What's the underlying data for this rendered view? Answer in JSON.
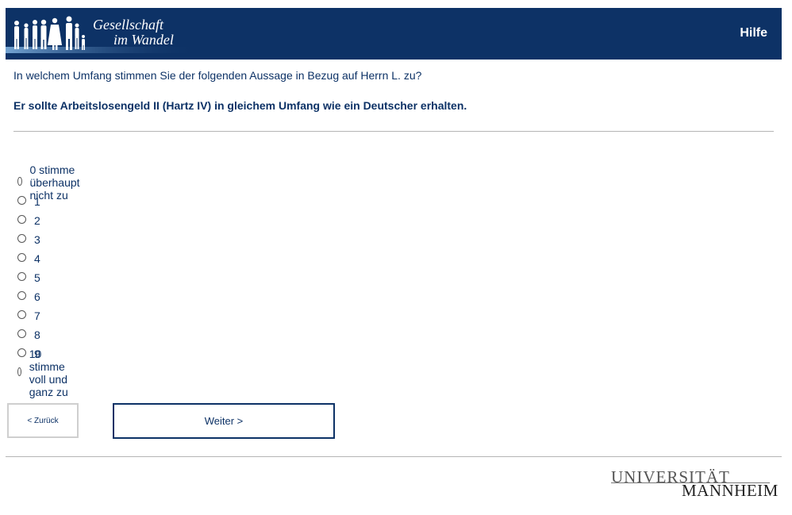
{
  "header": {
    "logo_line1": "Gesellschaft",
    "logo_line2": "im Wandel",
    "help_label": "Hilfe"
  },
  "question": {
    "text": "In welchem Umfang stimmen Sie der folgenden Aussage in Bezug auf Herrn L. zu?",
    "statement": "Er sollte Arbeitslosengeld II (Hartz IV) in gleichem Umfang wie ein Deutscher erhalten."
  },
  "options": [
    "0 stimme überhaupt nicht zu",
    "1",
    "2",
    "3",
    "4",
    "5",
    "6",
    "7",
    "8",
    "9",
    "10 stimme voll und ganz zu"
  ],
  "nav": {
    "back_label": "< Zurück",
    "next_label": "Weiter >"
  },
  "footer": {
    "logo_top": "UNIVERSITÄT",
    "logo_bottom": "MANNHEIM"
  },
  "colors": {
    "brand": "#0d3266"
  }
}
